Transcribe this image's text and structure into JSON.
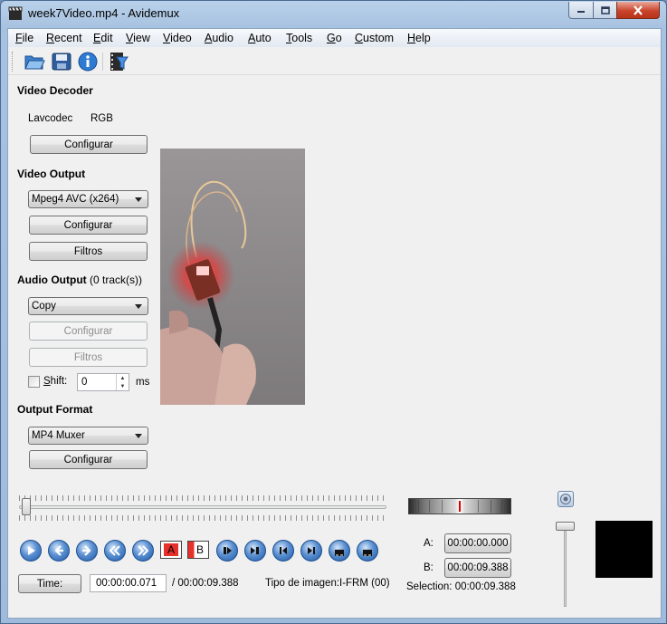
{
  "window": {
    "title": "week7Video.mp4 - Avidemux"
  },
  "menu": {
    "items": [
      {
        "label": "File",
        "accel": "F",
        "rest": "ile"
      },
      {
        "label": "Recent",
        "accel": "R",
        "rest": "ecent"
      },
      {
        "label": "Edit",
        "accel": "E",
        "rest": "dit"
      },
      {
        "label": "View",
        "accel": "V",
        "rest": "iew"
      },
      {
        "label": "Video",
        "accel": "V",
        "rest": "ideo"
      },
      {
        "label": "Audio",
        "accel": "A",
        "rest": "udio"
      },
      {
        "label": "Auto",
        "accel": "A",
        "rest": "uto"
      },
      {
        "label": "Tools",
        "accel": "T",
        "rest": "ools"
      },
      {
        "label": "Go",
        "accel": "G",
        "rest": "o"
      },
      {
        "label": "Custom",
        "accel": "C",
        "rest": "ustom"
      },
      {
        "label": "Help",
        "accel": "H",
        "rest": "elp"
      }
    ]
  },
  "toolbar": {
    "icons": [
      "open-folder-icon",
      "save-disk-icon",
      "info-icon",
      "film-filter-icon"
    ]
  },
  "video_decoder": {
    "title": "Video Decoder",
    "decoder_name": "Lavcodec",
    "format": "RGB",
    "configure_label": "Configurar"
  },
  "video_output": {
    "title": "Video Output",
    "codec_selected": "Mpeg4 AVC (x264)",
    "configure_label": "Configurar",
    "filters_label": "Filtros"
  },
  "audio_output": {
    "title": "Audio Output",
    "tracks": "(0 track(s))",
    "codec_selected": "Copy",
    "configure_label": "Configurar",
    "filters_label": "Filtros",
    "shift_label": "Shift:",
    "shift_accel": "S",
    "shift_rest": "hift:",
    "shift_value": "0",
    "shift_unit": "ms"
  },
  "output_format": {
    "title": "Output Format",
    "muxer_selected": "MP4 Muxer",
    "configure_label": "Configurar"
  },
  "playback": {
    "position_fraction": 0.0076,
    "time_button_label": "Time:",
    "current_time": "00:00:00.071",
    "total_time": "/ 00:00:09.388",
    "frame_type_label": "Tipo de imagen:",
    "frame_type_value": "I-FRM (00)",
    "marker_a_label": "A:",
    "marker_a_value": "00:00:00.000",
    "marker_b_label": "B:",
    "marker_b_value": "00:00:09.388",
    "selection_label": "Selection: 00:00:09.388",
    "ab_a_label": "A",
    "ab_b_label": "B",
    "volume_fraction": 0.97
  },
  "colors": {
    "title_bar": "#b9d1ea",
    "close_button": "#c8452c",
    "nav_button": "#1f5aa8",
    "marker_a": "#e8302a"
  }
}
